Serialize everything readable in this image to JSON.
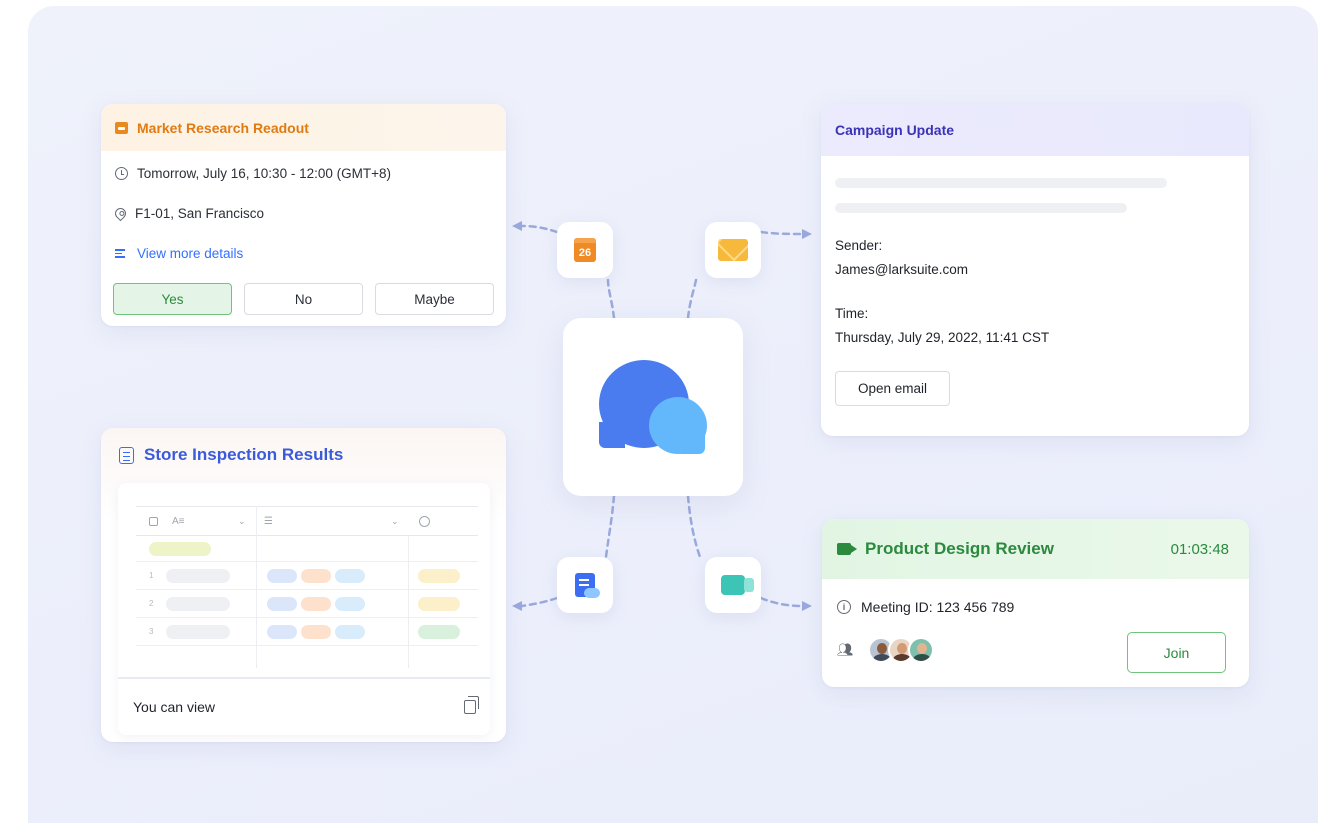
{
  "meeting_card": {
    "title": "Market Research Readout",
    "time": "Tomorrow, July 16, 10:30 - 12:00 (GMT+8)",
    "location": "F1-01, San Francisco",
    "details_link": "View more details",
    "rsvp": {
      "yes": "Yes",
      "no": "No",
      "maybe": "Maybe"
    },
    "accent": "#e07b12"
  },
  "sheet_card": {
    "title": "Store Inspection Results",
    "row_numbers": [
      "1",
      "2",
      "3"
    ],
    "footer_text": "You can view",
    "accent": "#3b5bdb"
  },
  "email_card": {
    "title": "Campaign Update",
    "sender_label": "Sender:",
    "sender_value": "James@larksuite.com",
    "time_label": "Time:",
    "time_value": "Thursday, July 29, 2022, 11:41 CST",
    "open_button": "Open email",
    "accent": "#3a33b8"
  },
  "video_card": {
    "title": "Product Design Review",
    "duration": "01:03:48",
    "meeting_id": "Meeting ID: 123 456 789",
    "join_button": "Join",
    "accent": "#2b8a3e"
  },
  "app_tiles": {
    "calendar_day": "26",
    "icons": [
      "calendar-icon",
      "mail-icon",
      "docs-icon",
      "video-icon",
      "chat-bubbles-icon"
    ]
  }
}
